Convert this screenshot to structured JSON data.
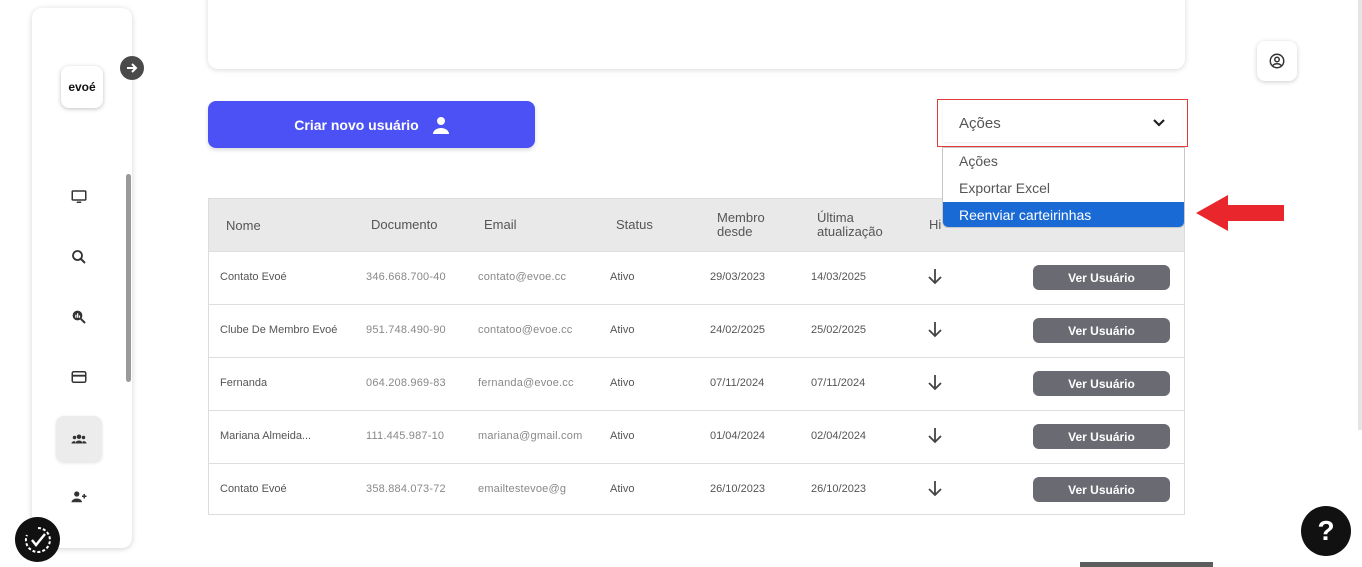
{
  "sidebar": {
    "logo_text": "evoé",
    "items": [
      {
        "icon": "monitor-icon"
      },
      {
        "icon": "search-icon"
      },
      {
        "icon": "search-analytics-icon"
      },
      {
        "icon": "card-icon"
      },
      {
        "icon": "users-group-icon",
        "active": true
      },
      {
        "icon": "user-add-icon"
      }
    ]
  },
  "actions": {
    "create_user_label": "Criar novo usuário",
    "select_value": "Ações",
    "options": [
      "Ações",
      "Exportar Excel",
      "Reenviar carteirinhas"
    ],
    "highlighted_option": "Reenviar carteirinhas"
  },
  "table": {
    "headers": {
      "nome": "Nome",
      "documento": "Documento",
      "email": "Email",
      "status": "Status",
      "membro1": "Membro",
      "membro2": "desde",
      "ultima1": "Última",
      "ultima2": "atualização",
      "historico": "Hi"
    },
    "button_label": "Ver Usuário",
    "rows": [
      {
        "nome": "Contato Evoé",
        "documento": "346.668.700-40",
        "email": "contato@evoe.cc",
        "status": "Ativo",
        "membro": "29/03/2023",
        "ultima": "14/03/2025"
      },
      {
        "nome": "Clube De Membro Evoé",
        "documento": "951.748.490-90",
        "email": "contatoo@evoe.cc",
        "status": "Ativo",
        "membro": "24/02/2025",
        "ultima": "25/02/2025"
      },
      {
        "nome": "Fernanda",
        "documento": "064.208.969-83",
        "email": "fernanda@evoe.cc",
        "status": "Ativo",
        "membro": "07/11/2024",
        "ultima": "07/11/2024"
      },
      {
        "nome": "Mariana Almeida...",
        "documento": "111.445.987-10",
        "email": "mariana@gmail.com",
        "status": "Ativo",
        "membro": "01/04/2024",
        "ultima": "02/04/2024"
      },
      {
        "nome": "Contato Evoé",
        "documento": "358.884.073-72",
        "email": "emailtestevoe@g",
        "status": "Ativo",
        "membro": "26/10/2023",
        "ultima": "26/10/2023"
      }
    ]
  },
  "help_label": "?",
  "colors": {
    "primary": "#4b51f5",
    "highlight": "#1a6ad6",
    "annotation": "#e53935",
    "button_gray": "#6a6b72"
  }
}
